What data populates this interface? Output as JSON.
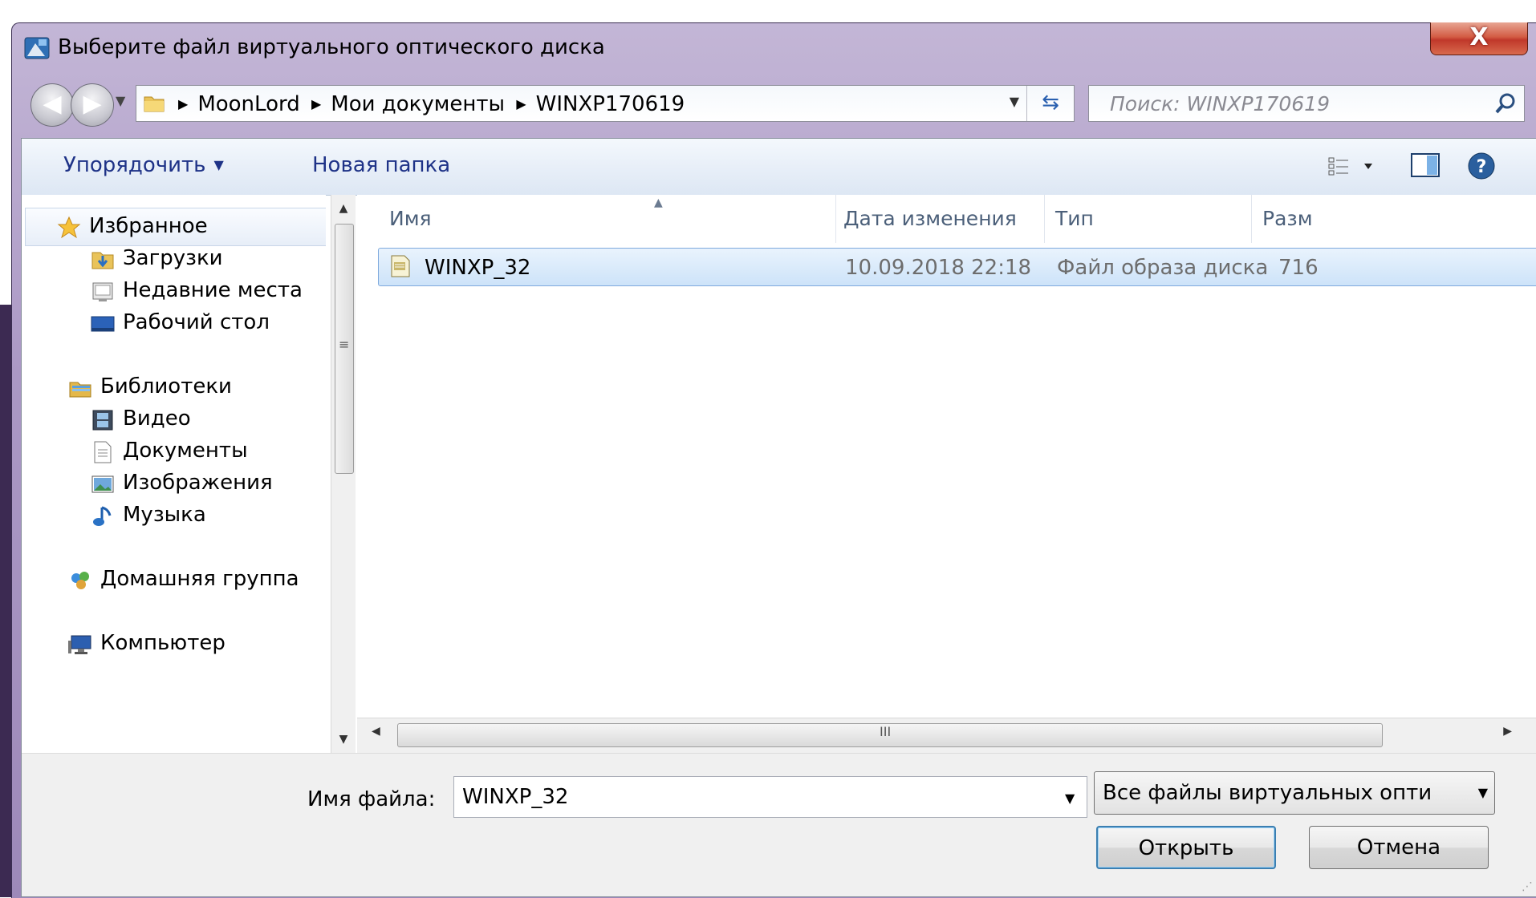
{
  "window": {
    "title": "Выберите файл виртуального оптического диска",
    "close_label": "X"
  },
  "address_bar": {
    "crumbs": [
      "MoonLord",
      "Мои документы",
      "WINXP170619"
    ]
  },
  "search": {
    "placeholder": "Поиск: WINXP170619"
  },
  "toolbar": {
    "organize_label": "Упорядочить",
    "new_folder_label": "Новая папка"
  },
  "nav_pane": {
    "favorites": "Избранное",
    "downloads": "Загрузки",
    "recent": "Недавние места",
    "desktop": "Рабочий стол",
    "libraries": "Библиотеки",
    "video": "Видео",
    "documents": "Документы",
    "images": "Изображения",
    "music": "Музыка",
    "homegroup": "Домашняя группа",
    "computer": "Компьютер"
  },
  "file_list": {
    "columns": [
      "Имя",
      "Дата изменения",
      "Тип",
      "Разм"
    ],
    "rows": [
      {
        "name": "WINXP_32",
        "date": "10.09.2018 22:18",
        "type": "Файл образа диска",
        "size": "716"
      }
    ]
  },
  "footer": {
    "filename_label": "Имя файла:",
    "filename_value": "WINXP_32",
    "filetype_value": "Все файлы виртуальных опти",
    "open_label": "Открыть",
    "cancel_label": "Отмена"
  },
  "colors": {
    "frame": "#ab98c5",
    "selection": "#cde3f9",
    "toolbar_text": "#1e3287"
  }
}
